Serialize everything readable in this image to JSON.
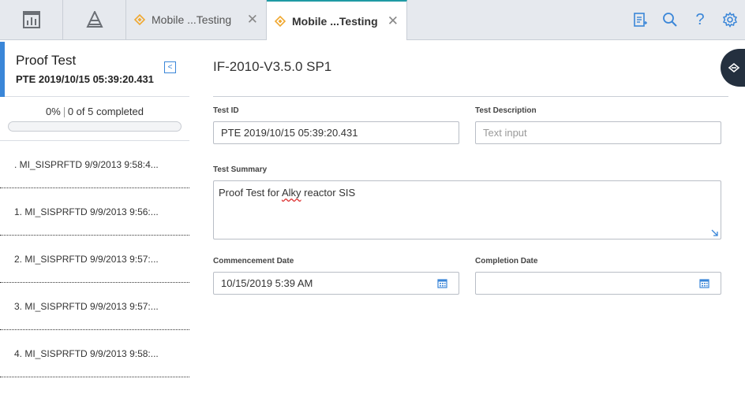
{
  "tabs": [
    {
      "label": "Mobile ...Testing",
      "active": false
    },
    {
      "label": "Mobile ...Testing",
      "active": true
    }
  ],
  "left_panel": {
    "title": "Proof Test",
    "subtitle": "PTE 2019/10/15 05:39:20.431",
    "progress_percent": "0%",
    "progress_status": "0 of 5 completed",
    "progress_value": 0,
    "items": [
      {
        "label": ". MI_SISPRFTD 9/9/2013 9:58:4..."
      },
      {
        "label": "1. MI_SISPRFTD 9/9/2013 9:56:..."
      },
      {
        "label": "2. MI_SISPRFTD 9/9/2013 9:57:..."
      },
      {
        "label": "3. MI_SISPRFTD 9/9/2013 9:57:..."
      },
      {
        "label": "4. MI_SISPRFTD 9/9/2013 9:58:..."
      }
    ]
  },
  "main": {
    "title": "IF-2010-V3.5.0 SP1",
    "test_id_label": "Test ID",
    "test_id_value": "PTE 2019/10/15 05:39:20.431",
    "test_description_label": "Test Description",
    "test_description_placeholder": "Text input",
    "test_summary_label": "Test Summary",
    "test_summary_pre": "Proof Test for ",
    "test_summary_misspelled": "Alky",
    "test_summary_post": " reactor SIS",
    "commencement_label": "Commencement Date",
    "commencement_value": "10/15/2019 5:39 AM",
    "completion_label": "Completion Date",
    "completion_value": ""
  },
  "colors": {
    "accent": "#3a86d8",
    "active_tab_border": "#1f9aa4",
    "tab_icon": "#f0a830",
    "float_button": "#24303f"
  },
  "icons": [
    "dashboard-icon",
    "asset-hierarchy-icon",
    "diamond-icon",
    "close-icon",
    "notes-icon",
    "search-icon",
    "help-icon",
    "settings-icon",
    "collapse-icon",
    "calendar-icon",
    "resize-icon",
    "hide-panel-icon"
  ]
}
